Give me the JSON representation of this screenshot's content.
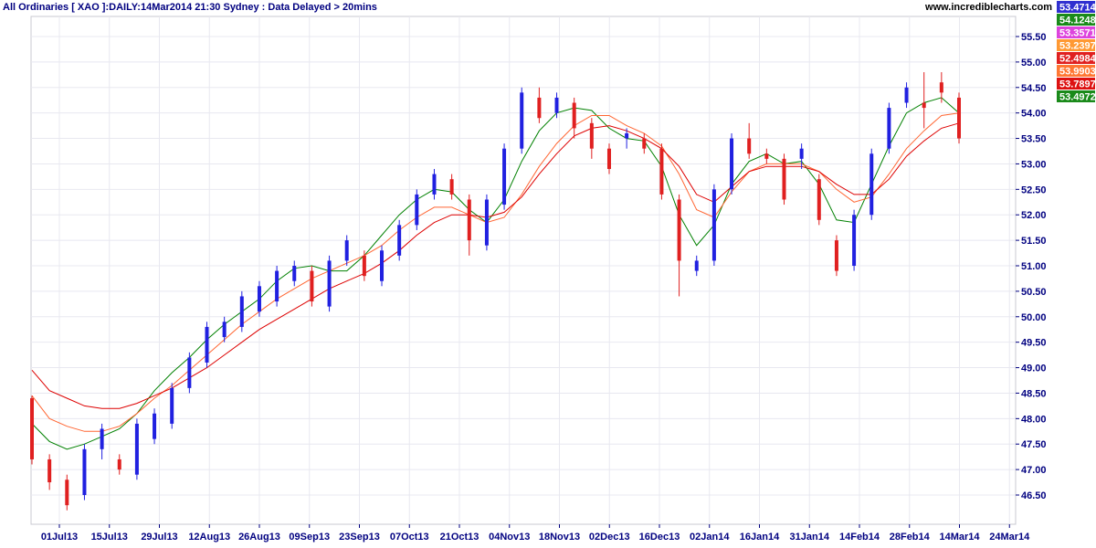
{
  "header": {
    "title": "All Ordinaries [ XAO ]:DAILY:14Mar2014 21:30 Sydney : Data Delayed > 20mins",
    "site": "www.incrediblecharts.com"
  },
  "chart_data": {
    "type": "candlestick",
    "x_ticks": [
      "01Jul13",
      "15Jul13",
      "29Jul13",
      "12Aug13",
      "26Aug13",
      "09Sep13",
      "23Sep13",
      "07Oct13",
      "21Oct13",
      "04Nov13",
      "18Nov13",
      "02Dec13",
      "16Dec13",
      "02Jan14",
      "16Jan14",
      "31Jan14",
      "14Feb14",
      "28Feb14",
      "14Mar14",
      "24Mar14"
    ],
    "y_ticks": [
      "46.50",
      "47.00",
      "47.50",
      "48.00",
      "48.50",
      "49.00",
      "49.50",
      "50.00",
      "50.50",
      "51.00",
      "51.50",
      "52.00",
      "52.50",
      "53.00",
      "53.50",
      "54.00",
      "54.50",
      "55.00",
      "55.50"
    ],
    "ylim": [
      46.0,
      56.0
    ],
    "colors": {
      "up": "#2020e0",
      "down": "#e02020",
      "ma_short": "#008000",
      "ma_mid": "#ff6633",
      "ma_long": "#dd0000",
      "grid": "#e8e8f0"
    },
    "series": [
      {
        "name": "ma_short",
        "color": "#008000",
        "values": [
          47.9,
          47.55,
          47.4,
          47.5,
          47.65,
          47.8,
          48.1,
          48.55,
          48.9,
          49.2,
          49.55,
          49.85,
          50.1,
          50.35,
          50.7,
          50.95,
          51.0,
          50.9,
          50.9,
          51.2,
          51.6,
          52.0,
          52.3,
          52.5,
          52.45,
          52.1,
          51.85,
          52.3,
          53.05,
          53.65,
          54.0,
          54.1,
          54.05,
          53.7,
          53.5,
          53.45,
          52.95,
          52.0,
          51.4,
          51.8,
          52.6,
          53.05,
          53.2,
          53.0,
          53.05,
          52.6,
          51.9,
          51.85,
          52.6,
          53.35,
          54.0,
          54.2,
          54.3,
          54.0
        ]
      },
      {
        "name": "ma_mid",
        "color": "#ff6633",
        "values": [
          48.45,
          48.0,
          47.85,
          47.75,
          47.75,
          47.85,
          48.1,
          48.4,
          48.65,
          48.95,
          49.25,
          49.55,
          49.85,
          50.1,
          50.35,
          50.55,
          50.75,
          50.9,
          51.05,
          51.2,
          51.4,
          51.7,
          51.95,
          52.15,
          52.15,
          52.0,
          51.85,
          51.95,
          52.4,
          52.95,
          53.4,
          53.75,
          53.95,
          53.95,
          53.75,
          53.6,
          53.35,
          52.8,
          52.1,
          51.95,
          52.45,
          52.85,
          53.0,
          53.0,
          53.0,
          52.85,
          52.5,
          52.25,
          52.35,
          52.8,
          53.3,
          53.65,
          53.95,
          54.0
        ]
      },
      {
        "name": "ma_long",
        "color": "#dd0000",
        "values": [
          48.95,
          48.55,
          48.4,
          48.25,
          48.2,
          48.2,
          48.3,
          48.45,
          48.6,
          48.8,
          49.0,
          49.25,
          49.5,
          49.75,
          49.95,
          50.15,
          50.35,
          50.55,
          50.7,
          50.85,
          51.05,
          51.3,
          51.6,
          51.85,
          52.0,
          52.0,
          51.95,
          52.05,
          52.35,
          52.8,
          53.2,
          53.55,
          53.7,
          53.75,
          53.65,
          53.5,
          53.3,
          52.95,
          52.4,
          52.25,
          52.55,
          52.85,
          52.95,
          52.95,
          52.95,
          52.85,
          52.6,
          52.4,
          52.4,
          52.7,
          53.15,
          53.45,
          53.7,
          53.8
        ]
      }
    ],
    "candles": [
      [
        48.4,
        47.2,
        48.45,
        47.1
      ],
      [
        47.2,
        46.75,
        47.3,
        46.6
      ],
      [
        46.8,
        46.3,
        46.9,
        46.2
      ],
      [
        46.5,
        47.4,
        47.5,
        46.4
      ],
      [
        47.4,
        47.8,
        47.9,
        47.2
      ],
      [
        47.2,
        47.0,
        47.3,
        46.9
      ],
      [
        46.9,
        47.9,
        48.0,
        46.8
      ],
      [
        47.6,
        48.1,
        48.2,
        47.5
      ],
      [
        47.9,
        48.6,
        48.7,
        47.8
      ],
      [
        48.6,
        49.2,
        49.3,
        48.5
      ],
      [
        49.1,
        49.8,
        49.9,
        49.0
      ],
      [
        49.6,
        49.9,
        50.0,
        49.5
      ],
      [
        49.8,
        50.4,
        50.5,
        49.7
      ],
      [
        50.1,
        50.6,
        50.7,
        50.0
      ],
      [
        50.3,
        50.9,
        51.0,
        50.2
      ],
      [
        50.7,
        51.0,
        51.1,
        50.6
      ],
      [
        50.9,
        50.3,
        51.0,
        50.2
      ],
      [
        50.2,
        51.1,
        51.2,
        50.1
      ],
      [
        51.1,
        51.5,
        51.6,
        51.0
      ],
      [
        51.2,
        50.8,
        51.3,
        50.7
      ],
      [
        50.7,
        51.3,
        51.4,
        50.6
      ],
      [
        51.2,
        51.8,
        51.9,
        51.1
      ],
      [
        51.8,
        52.4,
        52.5,
        51.7
      ],
      [
        52.4,
        52.8,
        52.9,
        52.3
      ],
      [
        52.7,
        52.4,
        52.8,
        52.3
      ],
      [
        52.3,
        51.5,
        52.4,
        51.2
      ],
      [
        51.4,
        52.3,
        52.4,
        51.3
      ],
      [
        52.2,
        53.3,
        53.4,
        52.1
      ],
      [
        53.3,
        54.4,
        54.5,
        53.2
      ],
      [
        54.3,
        53.9,
        54.5,
        53.8
      ],
      [
        54.0,
        54.3,
        54.4,
        53.9
      ],
      [
        54.2,
        53.7,
        54.3,
        53.5
      ],
      [
        53.8,
        53.3,
        53.9,
        53.1
      ],
      [
        53.3,
        52.9,
        53.4,
        52.8
      ],
      [
        53.5,
        53.6,
        53.7,
        53.3
      ],
      [
        53.5,
        53.3,
        53.6,
        53.2
      ],
      [
        53.3,
        52.4,
        53.4,
        52.3
      ],
      [
        52.3,
        51.1,
        52.4,
        50.4
      ],
      [
        50.9,
        51.1,
        51.2,
        50.8
      ],
      [
        51.1,
        52.5,
        52.6,
        51.0
      ],
      [
        52.5,
        53.5,
        53.6,
        52.4
      ],
      [
        53.5,
        53.2,
        53.8,
        53.1
      ],
      [
        53.2,
        53.1,
        53.3,
        53.0
      ],
      [
        53.1,
        52.3,
        53.2,
        52.2
      ],
      [
        53.1,
        53.3,
        53.4,
        52.9
      ],
      [
        52.7,
        51.9,
        52.8,
        51.8
      ],
      [
        51.5,
        50.9,
        51.6,
        50.8
      ],
      [
        51.0,
        52.0,
        52.1,
        50.9
      ],
      [
        52.0,
        53.2,
        53.3,
        51.9
      ],
      [
        53.3,
        54.1,
        54.2,
        53.2
      ],
      [
        54.2,
        54.5,
        54.6,
        54.1
      ],
      [
        54.2,
        54.1,
        54.8,
        53.7
      ],
      [
        54.6,
        54.4,
        54.8,
        54.2
      ],
      [
        54.3,
        53.5,
        54.4,
        53.4
      ]
    ],
    "price_labels": [
      {
        "text": "53.4714",
        "value": 53.4714,
        "color": "#3030d0"
      },
      {
        "text": "54.1248",
        "value": 54.1248,
        "color": "#1a8a1a"
      },
      {
        "text": "53.3571",
        "value": 53.3571,
        "color": "#dd44dd"
      },
      {
        "text": "53.2397",
        "value": 53.2397,
        "color": "#ff9933"
      },
      {
        "text": "52.4984",
        "value": 52.4984,
        "color": "#e02020"
      },
      {
        "text": "53.9903",
        "value": 53.9903,
        "color": "#ff7733"
      },
      {
        "text": "53.7897",
        "value": 53.7897,
        "color": "#dd1111"
      },
      {
        "text": "53.4972",
        "value": 53.4972,
        "color": "#1a8a1a"
      }
    ]
  }
}
